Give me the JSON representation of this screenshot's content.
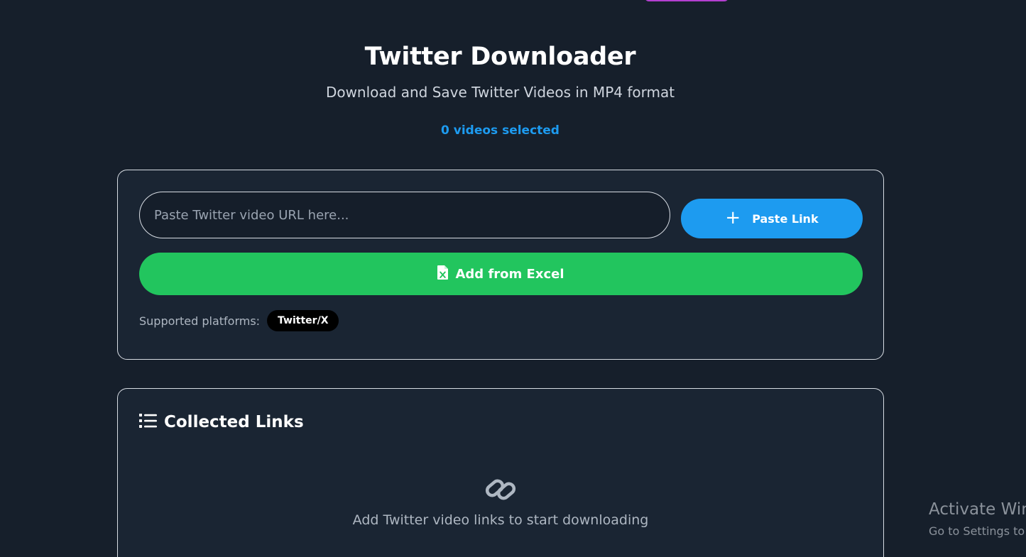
{
  "header": {
    "title": "Twitter Downloader",
    "subtitle": "Download and Save Twitter Videos in MP4 format",
    "selected_count": "0 videos selected"
  },
  "input_card": {
    "url_placeholder": "Paste Twitter video URL here...",
    "paste_button_label": "Paste Link",
    "excel_button_label": "Add from Excel",
    "platforms_label": "Supported platforms:",
    "platforms": [
      "Twitter/X"
    ]
  },
  "links_card": {
    "title": "Collected Links",
    "empty_text": "Add Twitter video links to start downloading"
  },
  "os_overlay": {
    "activate_title": "Activate Win",
    "activate_sub": "Go to Settings to"
  },
  "icons": {
    "paste": "plus-icon",
    "excel": "excel-file-icon",
    "list": "list-icon",
    "empty": "link-icon"
  },
  "colors": {
    "background": "#161f2b",
    "card": "#1a2533",
    "accent_blue": "#1d9bf0",
    "accent_green": "#22c55e",
    "top_accent": "#b43fd0"
  }
}
